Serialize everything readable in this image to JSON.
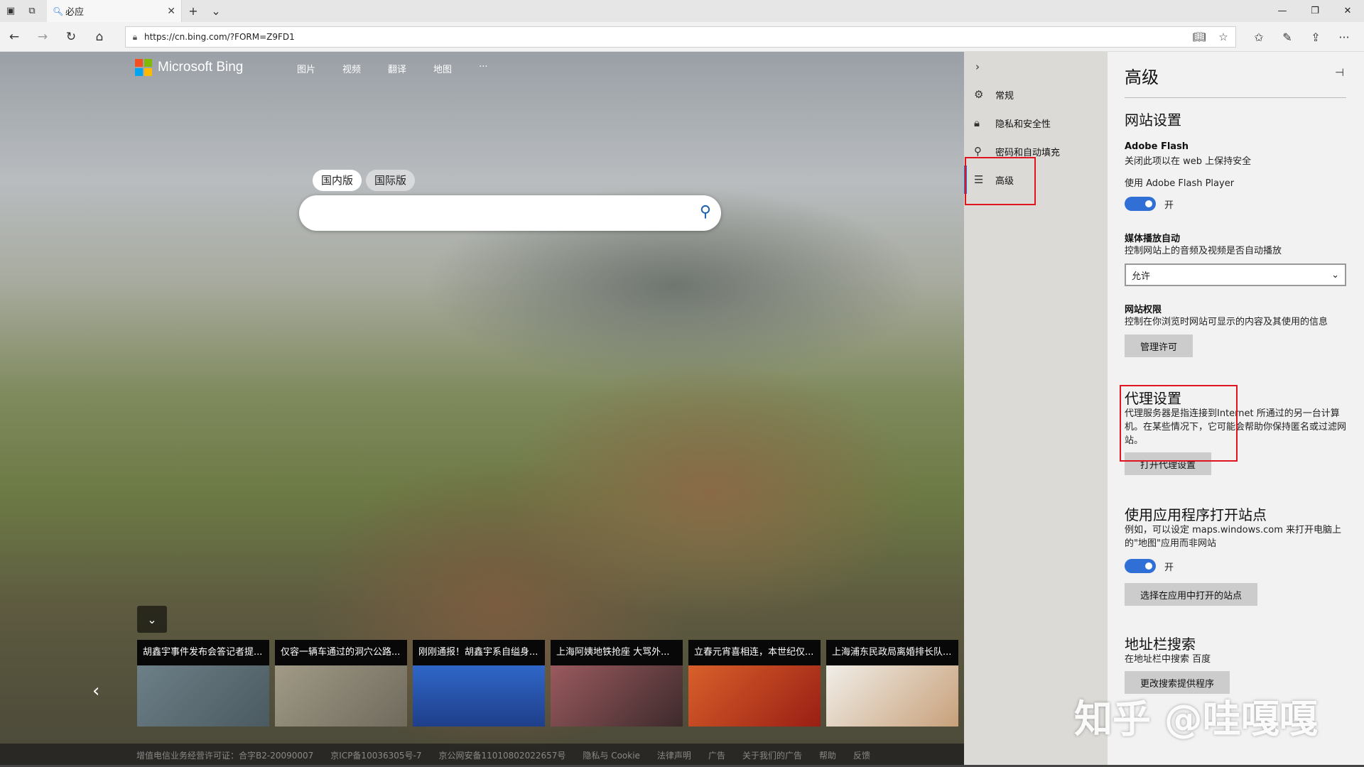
{
  "window": {
    "tab_title": "必应",
    "close_tab": "✕",
    "new_tab": "+",
    "tab_menu": "⌄"
  },
  "address_bar": {
    "url": "https://cn.bing.com/?FORM=Z9FD1"
  },
  "bing": {
    "logo_text": "Microsoft Bing",
    "nav": [
      "图片",
      "视频",
      "翻译",
      "地图",
      "···"
    ],
    "region_tabs": [
      "国内版",
      "国际版"
    ],
    "search_placeholder": "",
    "news": [
      {
        "caption": "胡鑫宇事件发布会答记者提...",
        "color": "#5d6f7a"
      },
      {
        "caption": "仅容一辆车通过的洞穴公路...",
        "color": "#8c8878"
      },
      {
        "caption": "刚刚通报！胡鑫宇系自缢身...",
        "color": "#2f66c8"
      },
      {
        "caption": "上海阿姨地铁抢座 大骂外...",
        "color": "#8a4a50"
      },
      {
        "caption": "立春元宵喜相连，本世纪仅...",
        "color": "#c0401e"
      },
      {
        "caption": "上海浦东民政局离婚排长队...",
        "color": "#e8e6e0"
      }
    ],
    "footer": [
      "增值电信业务经营许可证：合字B2-20090007",
      "京ICP备10036305号-7",
      "京公网安备11010802022657号",
      "隐私与 Cookie",
      "法律声明",
      "广告",
      "关于我们的广告",
      "帮助",
      "反馈"
    ]
  },
  "settings_nav": {
    "items": [
      {
        "label": "常规",
        "icon": "gear-icon",
        "glyph": "⚙"
      },
      {
        "label": "隐私和安全性",
        "icon": "lock-icon",
        "glyph": "🔒"
      },
      {
        "label": "密码和自动填充",
        "icon": "key-icon",
        "glyph": "⚲"
      },
      {
        "label": "高级",
        "icon": "sliders-icon",
        "glyph": "☰"
      }
    ]
  },
  "settings_panel": {
    "title": "高级",
    "section_site": "网站设置",
    "flash_title": "Adobe Flash",
    "flash_desc": "关闭此项以在 web 上保持安全",
    "flash_toggle_label": "使用 Adobe Flash Player",
    "flash_toggle_state": "开",
    "media_title": "媒体播放自动",
    "media_desc": "控制网站上的音频及视频是否自动播放",
    "media_value": "允许",
    "perm_title": "网站权限",
    "perm_desc": "控制在你浏览时网站可显示的内容及其使用的信息",
    "perm_button": "管理许可",
    "proxy_title": "代理设置",
    "proxy_desc": "代理服务器是指连接到Internet 所通过的另一台计算机。在某些情况下，它可能会帮助你保持匿名或过滤网站。",
    "proxy_button": "打开代理设置",
    "apps_title": "使用应用程序打开站点",
    "apps_desc": "例如，可以设定 maps.windows.com 来打开电脑上的\"地图\"应用而非网站",
    "apps_toggle_state": "开",
    "apps_button": "选择在应用中打开的站点",
    "addr_title": "地址栏搜索",
    "addr_desc": "在地址栏中搜索 百度",
    "addr_button": "更改搜索提供程序"
  },
  "watermark": "知乎 @哇嘎嘎",
  "colors": {
    "accent": "#2f6fd6",
    "highlight": "#e0141e"
  }
}
